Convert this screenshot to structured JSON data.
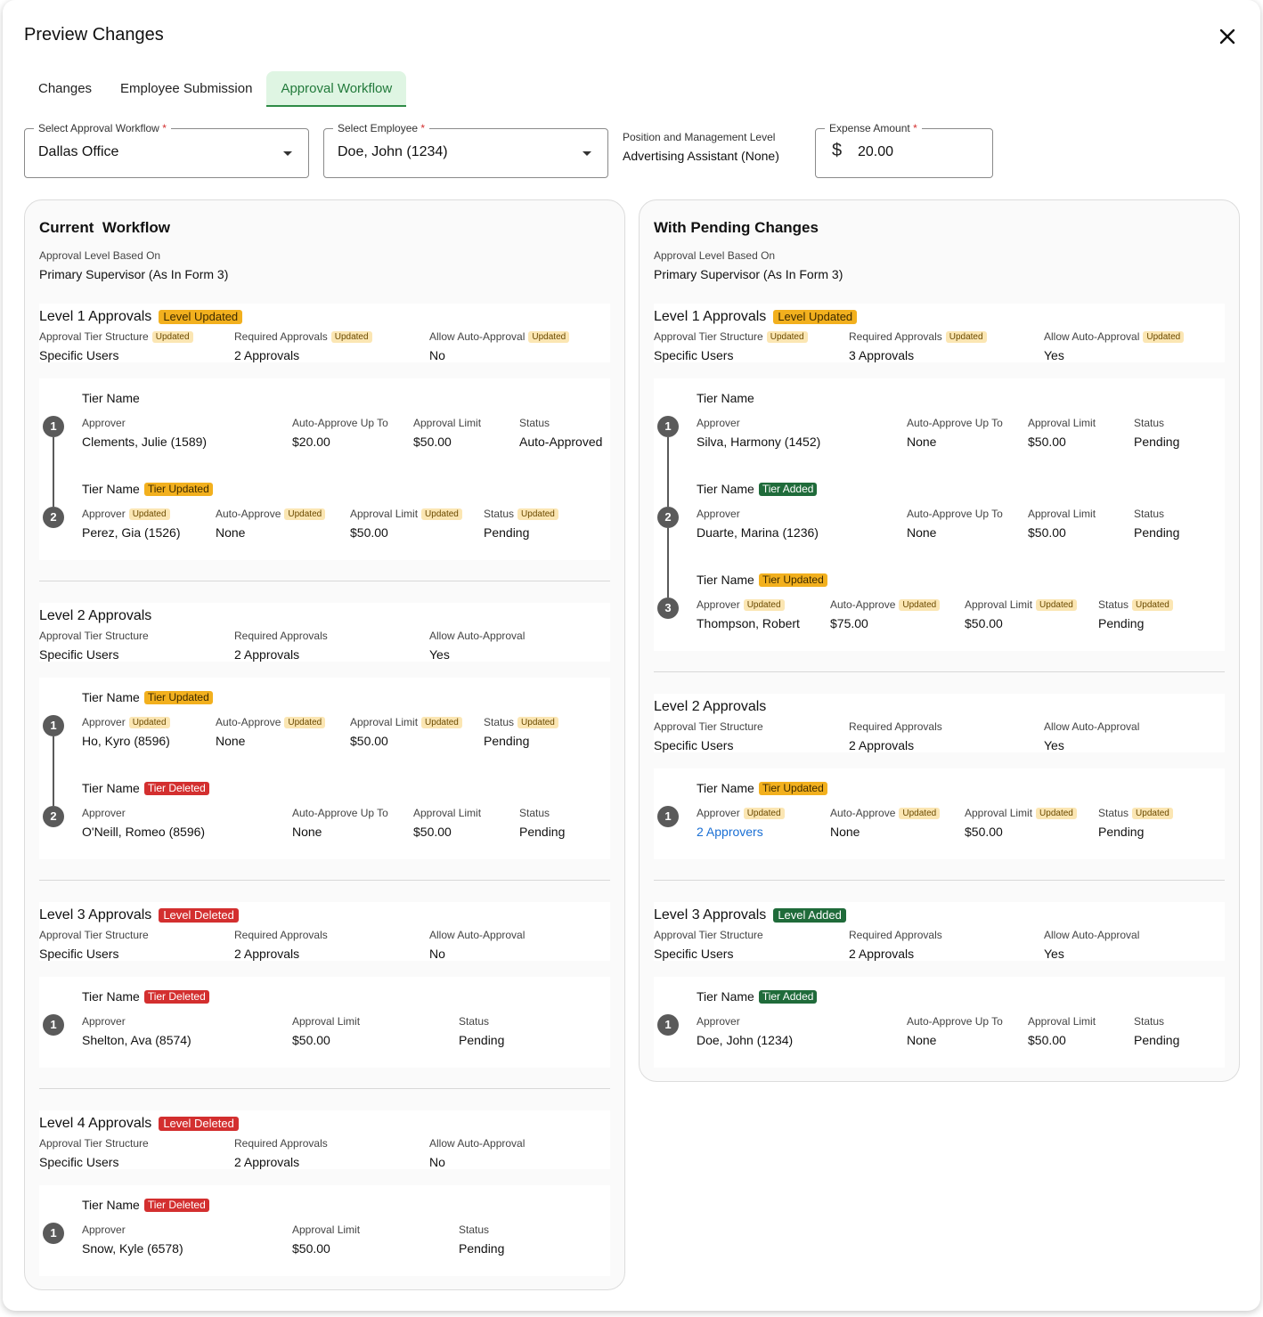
{
  "dialog": {
    "title": "Preview Changes",
    "close_icon": "close-icon"
  },
  "tabs": [
    {
      "label": "Changes",
      "active": false
    },
    {
      "label": "Employee Submission",
      "active": false
    },
    {
      "label": "Approval Workflow",
      "active": true
    }
  ],
  "filters": {
    "workflow": {
      "label": "Select Approval Workflow",
      "required": "*",
      "value": "Dallas Office"
    },
    "employee": {
      "label": "Select Employee",
      "required": "*",
      "value": "Doe, John (1234)"
    },
    "position": {
      "label": "Position and Management Level",
      "value": "Advertising Assistant (None)"
    },
    "expense": {
      "label": "Expense Amount",
      "required": "*",
      "currency": "$",
      "value": "20.00"
    }
  },
  "labels": {
    "basis": "Approval Level Based On",
    "tier_structure": "Approval Tier Structure",
    "required": "Required Approvals",
    "auto_approval": "Allow Auto-Approval",
    "tier_name": "Tier Name",
    "approver": "Approver",
    "auto_up_to": "Auto-Approve Up To",
    "auto_approve": "Auto-Approve",
    "approval_limit": "Approval Limit",
    "status": "Status",
    "updated": "Updated"
  },
  "current": {
    "title": "Current  Workflow",
    "basis_value": "Primary Supervisor (As In Form 3)",
    "levels": [
      {
        "title": "Level 1 Approvals",
        "badge": "Level Updated",
        "structure": "Specific Users",
        "required": "2 Approvals",
        "auto": "No",
        "tiers": [
          {
            "approver": "Clements, Julie (1589)",
            "auto": "$20.00",
            "limit": "$50.00",
            "status": "Auto-Approved"
          },
          {
            "badge": "Tier Updated",
            "approver": "Perez, Gia (1526)",
            "auto": "None",
            "limit": "$50.00",
            "status": "Pending"
          }
        ]
      },
      {
        "title": "Level 2 Approvals",
        "structure": "Specific Users",
        "required": "2 Approvals",
        "auto": "Yes",
        "tiers": [
          {
            "badge": "Tier Updated",
            "approver": "Ho, Kyro (8596)",
            "auto": "None",
            "limit": "$50.00",
            "status": "Pending"
          },
          {
            "badge": "Tier Deleted",
            "approver": "O'Neill, Romeo (8596)",
            "auto": "None",
            "limit": "$50.00",
            "status": "Pending"
          }
        ]
      },
      {
        "title": "Level 3 Approvals",
        "badge": "Level Deleted",
        "structure": "Specific Users",
        "required": "2 Approvals",
        "auto": "No",
        "tiers": [
          {
            "badge": "Tier Deleted",
            "approver": "Shelton, Ava (8574)",
            "limit": "$50.00",
            "status": "Pending"
          }
        ]
      },
      {
        "title": "Level 4 Approvals",
        "badge": "Level Deleted",
        "structure": "Specific Users",
        "required": "2 Approvals",
        "auto": "No",
        "tiers": [
          {
            "badge": "Tier Deleted",
            "approver": "Snow, Kyle (6578)",
            "limit": "$50.00",
            "status": "Pending"
          }
        ]
      }
    ]
  },
  "pending": {
    "title": "With Pending Changes",
    "basis_value": "Primary Supervisor (As In Form 3)",
    "levels": [
      {
        "title": "Level 1 Approvals",
        "badge": "Level Updated",
        "structure": "Specific Users",
        "required": "3 Approvals",
        "auto": "Yes",
        "tiers": [
          {
            "approver": "Silva, Harmony (1452)",
            "auto": "None",
            "limit": "$50.00",
            "status": "Pending"
          },
          {
            "badge": "Tier Added",
            "approver": "Duarte, Marina (1236)",
            "auto": "None",
            "limit": "$50.00",
            "status": "Pending"
          },
          {
            "badge": "Tier Updated",
            "approver": "Thompson, Robert",
            "auto": "$75.00",
            "limit": "$50.00",
            "status": "Pending"
          }
        ]
      },
      {
        "title": "Level 2 Approvals",
        "structure": "Specific Users",
        "required": "2 Approvals",
        "auto": "Yes",
        "tiers": [
          {
            "badge": "Tier Updated",
            "approver": "2 Approvers",
            "auto": "None",
            "limit": "$50.00",
            "status": "Pending"
          }
        ]
      },
      {
        "title": "Level 3 Approvals",
        "badge": "Level Added",
        "structure": "Specific Users",
        "required": "2 Approvals",
        "auto": "Yes",
        "tiers": [
          {
            "badge": "Tier Added",
            "approver": "Doe, John (1234)",
            "auto": "None",
            "limit": "$50.00",
            "status": "Pending"
          }
        ]
      }
    ]
  },
  "colors": {
    "accent": "#2e8b46",
    "updated": "#f2b01e",
    "added": "#1f6b3a",
    "deleted": "#d32f2f",
    "link": "#1a6fd4"
  }
}
